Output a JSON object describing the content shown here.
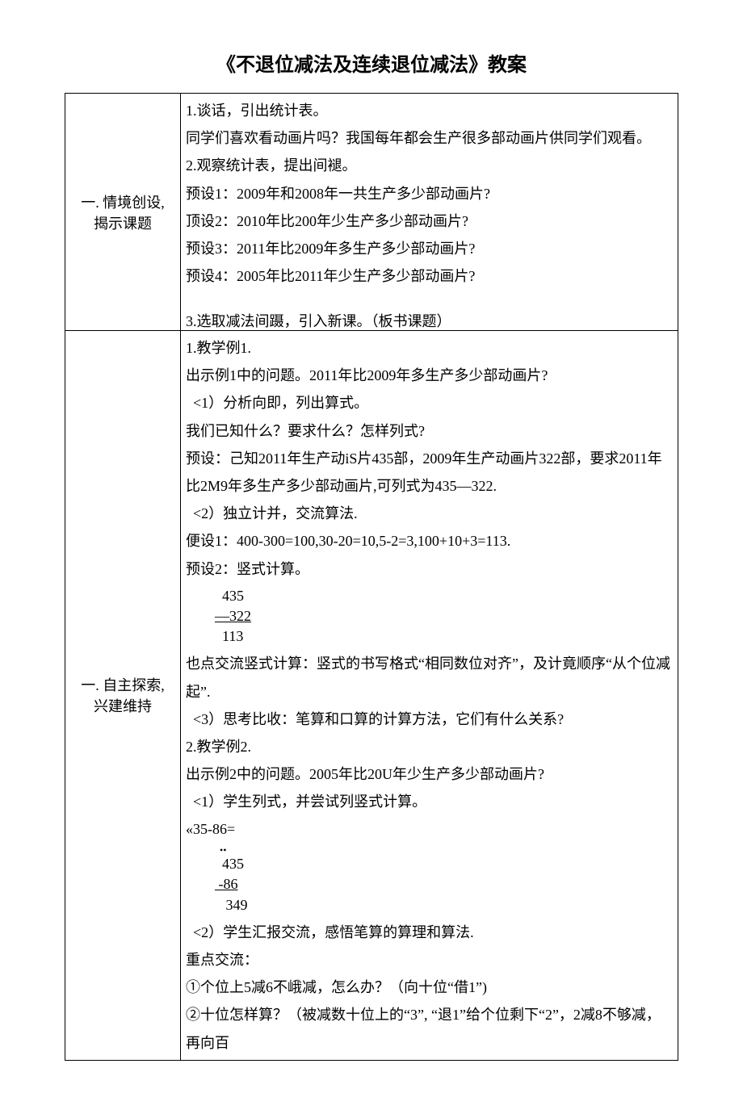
{
  "title": "《不退位减法及连续退位减法》教案",
  "row1": {
    "left_line1": "一. 情境创设,",
    "left_line2": "揭示课题",
    "r1": "1.谈话，引出统计表。",
    "r2": "同学们喜欢看动画片吗？我国每年都会生产很多部动画片供同学们观看。",
    "r3": "2.观察统计表，提出间褪。",
    "r4": "预设1：2009年和2008年一共生产多少部动画片?",
    "r5": "顶设2：2010年比200年少生产多少部动画片?",
    "r6": "预设3：2011年比2009年多生产多少部动画片?",
    "r7": "预设4：2005年比2011年少生产多少部动画片?",
    "r8": "3.选取减法间蹑，引入新课。（板书课题）"
  },
  "row2": {
    "left_line1": "一. 自主探索,",
    "left_line2": "兴建维持",
    "r1": "1.教学例1.",
    "r2": "出示例1中的问题。2011年比2009年多生产多少部动画片?",
    "r3": "  <1）分析向即，列出算式。",
    "r4": "我们已知什么？要求什么？怎样列式?",
    "r5": "预设：己知2011年生产动iS片435部，2009年生产动画片322部，要求2011年比2M9年多生产多少部动画片,可列式为435—322.",
    "r6": "  <2）独立计并，交流算法.",
    "r7": "便设1：400-300=100,30-20=10,5-2=3,100+10+3=113.",
    "r8": "预设2：竖式计算。",
    "calc1_a": "  435",
    "calc1_b": "—322",
    "calc1_c": "  113",
    "r9": "也点交流竖式计算：竖式的书写格式“相同数位对齐”，及计竟顺序“从个位减起”.",
    "r10": "  <3）思考比收：笔算和口算的计算方法，它们有什么关系?",
    "r11": "2.教学例2.",
    "r12": "出示例2中的问题。2005年比20U年少生产多少部动画片?",
    "r13": "  <1）学生列式，并尝试列竖式计算。",
    "r14": "«35-86=",
    "calc2_dots": "  ••",
    "calc2_a": "  435",
    "calc2_b": " -86",
    "calc2_c": "   349",
    "r15": "  <2）学生汇报交流，感悟笔算的算理和算法.",
    "r16": "重点交流：",
    "r17": "①个位上5减6不峨减，怎么办？（向十位“借1”)",
    "r18": "②十位怎样算？（被减数十位上的“3”, “退1”给个位剩下“2”，2减8不够减，再向百"
  }
}
